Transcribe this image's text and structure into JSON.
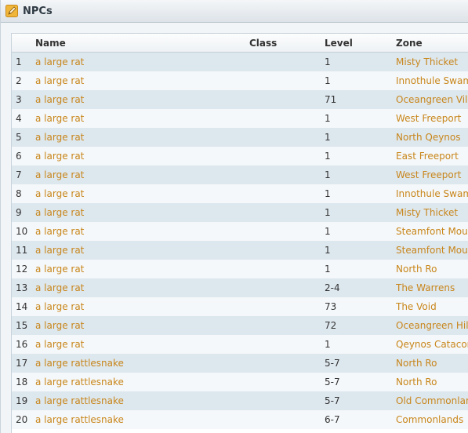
{
  "panel": {
    "title": "NPCs",
    "icon": "edit-icon"
  },
  "table": {
    "columns": {
      "num": "",
      "name": "Name",
      "class": "Class",
      "level": "Level",
      "zone": "Zone"
    },
    "rows": [
      {
        "num": "1",
        "name": "a large rat",
        "class": "",
        "level": "1",
        "zone": "Misty Thicket"
      },
      {
        "num": "2",
        "name": "a large rat",
        "class": "",
        "level": "1",
        "zone": "Innothule Swamp"
      },
      {
        "num": "3",
        "name": "a large rat",
        "class": "",
        "level": "71",
        "zone": "Oceangreen Village"
      },
      {
        "num": "4",
        "name": "a large rat",
        "class": "",
        "level": "1",
        "zone": "West Freeport"
      },
      {
        "num": "5",
        "name": "a large rat",
        "class": "",
        "level": "1",
        "zone": "North Qeynos"
      },
      {
        "num": "6",
        "name": "a large rat",
        "class": "",
        "level": "1",
        "zone": "East Freeport"
      },
      {
        "num": "7",
        "name": "a large rat",
        "class": "",
        "level": "1",
        "zone": "West Freeport"
      },
      {
        "num": "8",
        "name": "a large rat",
        "class": "",
        "level": "1",
        "zone": "Innothule Swamp"
      },
      {
        "num": "9",
        "name": "a large rat",
        "class": "",
        "level": "1",
        "zone": "Misty Thicket"
      },
      {
        "num": "10",
        "name": "a large rat",
        "class": "",
        "level": "1",
        "zone": "Steamfont Mountains"
      },
      {
        "num": "11",
        "name": "a large rat",
        "class": "",
        "level": "1",
        "zone": "Steamfont Mountains"
      },
      {
        "num": "12",
        "name": "a large rat",
        "class": "",
        "level": "1",
        "zone": "North Ro"
      },
      {
        "num": "13",
        "name": "a large rat",
        "class": "",
        "level": "2-4",
        "zone": "The Warrens"
      },
      {
        "num": "14",
        "name": "a large rat",
        "class": "",
        "level": "73",
        "zone": "The Void"
      },
      {
        "num": "15",
        "name": "a large rat",
        "class": "",
        "level": "72",
        "zone": "Oceangreen Hills"
      },
      {
        "num": "16",
        "name": "a large rat",
        "class": "",
        "level": "1",
        "zone": "Qeynos Catacombs"
      },
      {
        "num": "17",
        "name": "a large rattlesnake",
        "class": "",
        "level": "5-7",
        "zone": "North Ro"
      },
      {
        "num": "18",
        "name": "a large rattlesnake",
        "class": "",
        "level": "5-7",
        "zone": "North Ro"
      },
      {
        "num": "19",
        "name": "a large rattlesnake",
        "class": "",
        "level": "5-7",
        "zone": "Old Commonlands"
      },
      {
        "num": "20",
        "name": "a large rattlesnake",
        "class": "",
        "level": "6-7",
        "zone": "Commonlands"
      }
    ]
  },
  "colors": {
    "link": "#c8861b",
    "row_odd": "#dde7ee",
    "row_even": "#f5f8fa",
    "icon": "#f0b63a"
  }
}
